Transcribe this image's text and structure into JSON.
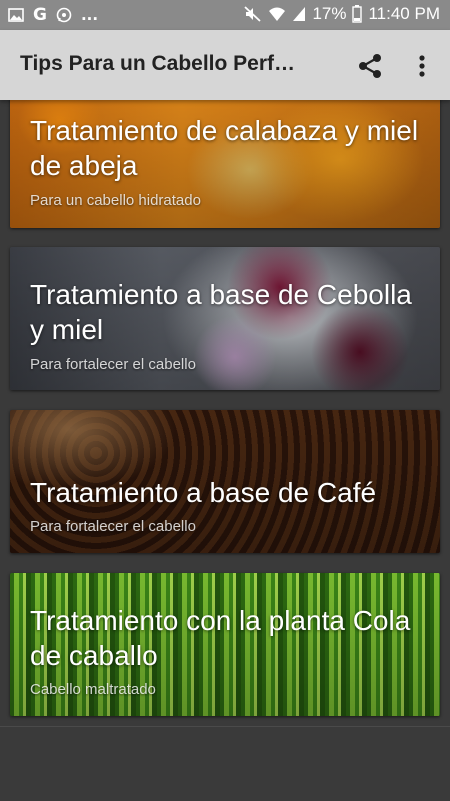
{
  "status": {
    "left_icons": [
      "image-icon",
      "google-icon",
      "whatsapp-icon",
      "more-dots-icon"
    ],
    "more_text": "...",
    "battery": "17%",
    "time": "11:40 PM"
  },
  "appbar": {
    "title": "Tips Para un Cabello Perf…"
  },
  "cards": [
    {
      "title": "Tratamiento de calabaza y miel de abeja",
      "subtitle": "Para un cabello hidratado",
      "image": "pumpkin"
    },
    {
      "title": "Tratamiento a base  de Cebolla y miel",
      "subtitle": "Para fortalecer el cabello",
      "image": "onion"
    },
    {
      "title": "Tratamiento a base  de  Café",
      "subtitle": "Para fortalecer el cabello",
      "image": "coffee"
    },
    {
      "title": "Tratamiento con la planta Cola de caballo",
      "subtitle": "Cabello maltratado",
      "image": "horsetail"
    }
  ]
}
